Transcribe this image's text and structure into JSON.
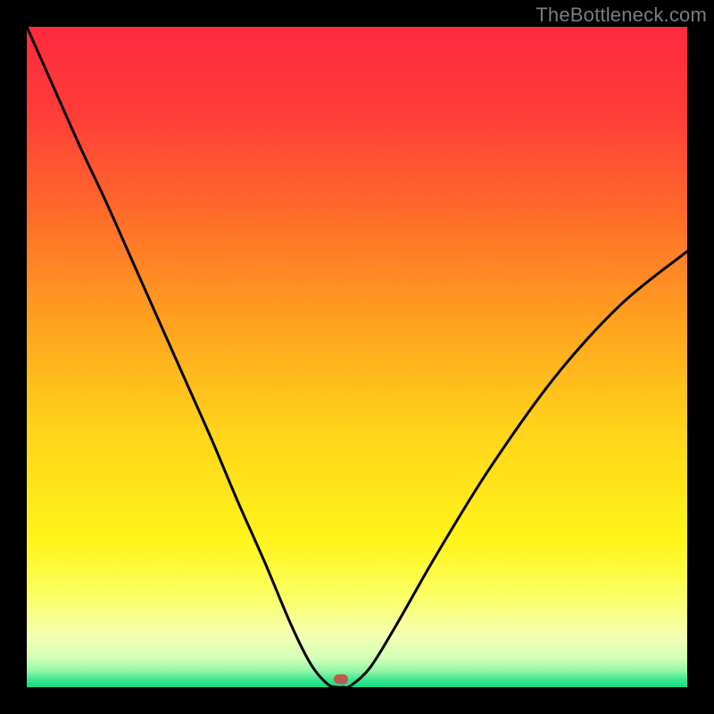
{
  "watermark": "TheBottleneck.com",
  "chart_data": {
    "type": "line",
    "title": "",
    "xlabel": "",
    "ylabel": "",
    "xlim": [
      0,
      1
    ],
    "ylim": [
      0,
      1
    ],
    "background_gradient_stops": [
      {
        "pos": 0.0,
        "color": "#ff2a3e"
      },
      {
        "pos": 0.12,
        "color": "#ff3a3a"
      },
      {
        "pos": 0.28,
        "color": "#ff6a2a"
      },
      {
        "pos": 0.45,
        "color": "#ffa21f"
      },
      {
        "pos": 0.62,
        "color": "#ffd61a"
      },
      {
        "pos": 0.78,
        "color": "#fff41a"
      },
      {
        "pos": 0.86,
        "color": "#fcff62"
      },
      {
        "pos": 0.92,
        "color": "#f4ffb0"
      },
      {
        "pos": 0.955,
        "color": "#d4ffb6"
      },
      {
        "pos": 0.975,
        "color": "#96f7a8"
      },
      {
        "pos": 0.988,
        "color": "#3ee793"
      },
      {
        "pos": 1.0,
        "color": "#17d985"
      }
    ],
    "series": [
      {
        "name": "bottleneck-curve",
        "x": [
          0.0,
          0.04,
          0.08,
          0.12,
          0.16,
          0.2,
          0.24,
          0.28,
          0.32,
          0.36,
          0.4,
          0.43,
          0.455,
          0.47,
          0.48,
          0.49,
          0.52,
          0.56,
          0.62,
          0.7,
          0.8,
          0.9,
          1.0
        ],
        "y": [
          1.0,
          0.91,
          0.82,
          0.735,
          0.645,
          0.555,
          0.465,
          0.375,
          0.28,
          0.19,
          0.095,
          0.035,
          0.005,
          0.0,
          0.0,
          0.002,
          0.03,
          0.095,
          0.2,
          0.33,
          0.47,
          0.58,
          0.66
        ]
      }
    ],
    "marker": {
      "x": 0.475,
      "y": 0.012,
      "color": "#c1574e"
    }
  }
}
